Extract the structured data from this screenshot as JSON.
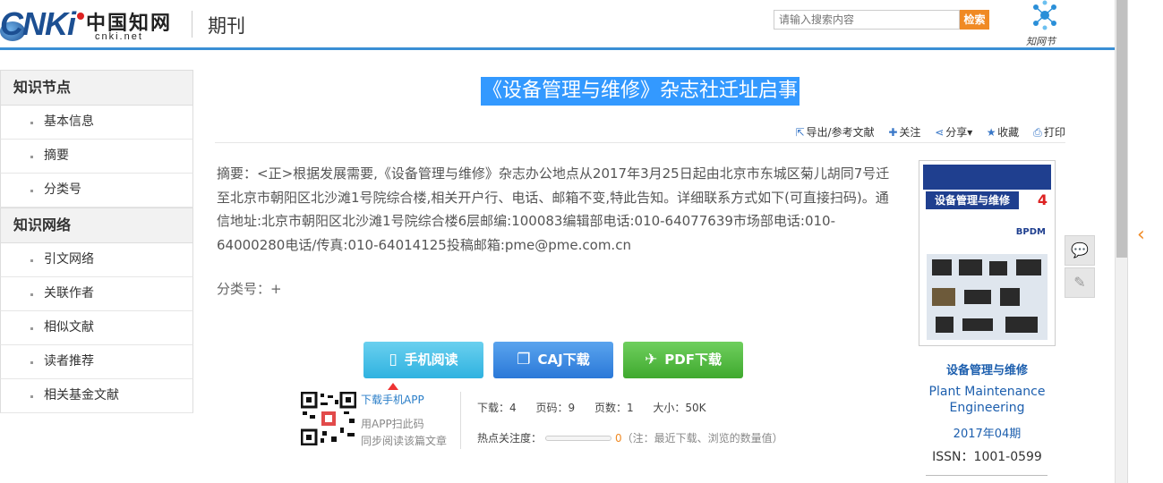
{
  "header": {
    "logo_text": "CNKi",
    "logo_cn": "中国知网",
    "logo_domain": "cnki.net",
    "section_title": "期刊",
    "search_placeholder": "请输入搜索内容",
    "search_button": "检索",
    "festival_label": "知网节"
  },
  "sidebar": {
    "sections": [
      {
        "title": "知识节点",
        "items": [
          "基本信息",
          "摘要",
          "分类号"
        ]
      },
      {
        "title": "知识网络",
        "items": [
          "引文网络",
          "关联作者",
          "相似文献",
          "读者推荐",
          "相关基金文献"
        ]
      }
    ]
  },
  "article": {
    "title": "《设备管理与维修》杂志社迁址启事",
    "abstract": "摘要：<正>根据发展需要,《设备管理与维修》杂志办公地点从2017年3月25日起由北京市东城区菊儿胡同7号迁至北京市朝阳区北沙滩1号院综合楼,相关开户行、电话、邮箱不变,特此告知。详细联系方式如下(可直接扫码)。通信地址:北京市朝阳区北沙滩1号院综合楼6层邮编:100083编辑部电话:010-64077639市场部电话:010-64000280电话/传真:010-64014125投稿邮箱:pme@pme.com.cn",
    "classno": "分类号：+"
  },
  "toolbar": {
    "export": "导出/参考文献",
    "follow": "关注",
    "share": "分享",
    "favorite": "收藏",
    "print": "打印"
  },
  "downloads": {
    "mobile": "手机阅读",
    "caj": "CAJ下载",
    "pdf": "PDF下载",
    "app_link": "下载手机APP",
    "app_line1": "用APP扫此码",
    "app_line2": "同步阅读该篇文章"
  },
  "stats": {
    "downloads": "下载：4",
    "pages": "页码：9",
    "page_count": "页数：1",
    "size": "大小：50K",
    "heat_label": "热点关注度：",
    "heat_value": "0",
    "heat_note": "（注：最近下载、浏览的数量值）"
  },
  "journal": {
    "name_cn": "设备管理与维修",
    "name_en": "Plant Maintenance Engineering",
    "issue": "2017年04期",
    "issn": "ISSN：1001-0599",
    "cover_title": "设备管理与维修",
    "cover_issue_no": "4",
    "cover_brand": "BPDM"
  },
  "colors": {
    "accent": "#3a8fd5",
    "search_button": "#f08a24",
    "title_highlight": "#3399ff",
    "link": "#1d5fae"
  }
}
